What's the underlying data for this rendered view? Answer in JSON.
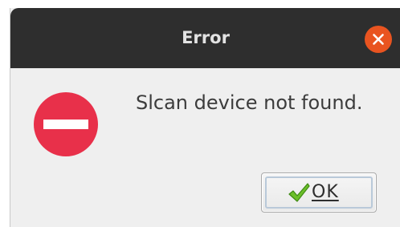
{
  "dialog": {
    "title": "Error",
    "message": "Slcan device not found.",
    "ok_label": "OK"
  },
  "icons": {
    "close": "close-icon",
    "error": "error-stop-icon",
    "ok": "checkmark-icon"
  },
  "colors": {
    "titlebar": "#2e2e2e",
    "close_button": "#e95420",
    "error_icon": "#e8304a",
    "checkmark": "#6cbf2a"
  }
}
